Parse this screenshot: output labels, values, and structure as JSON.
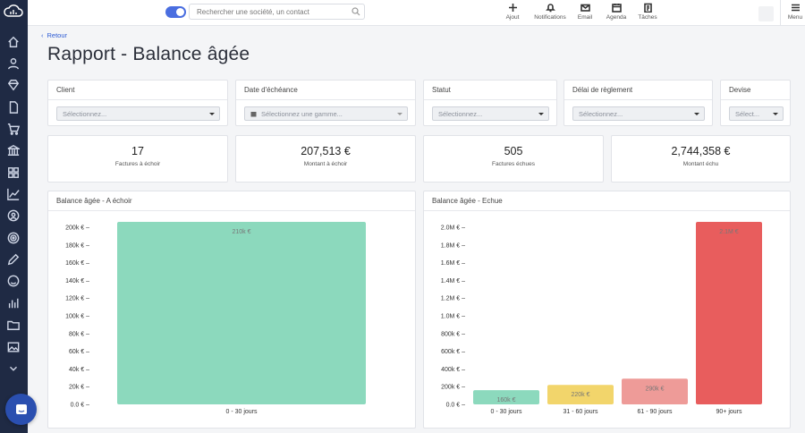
{
  "topbar": {
    "search_placeholder": "Rechercher une société, un contact",
    "actions": [
      {
        "label": "Ajout",
        "icon": "plus-icon"
      },
      {
        "label": "Notifications",
        "icon": "bell-icon"
      },
      {
        "label": "Email",
        "icon": "envelope-icon"
      },
      {
        "label": "Agenda",
        "icon": "calendar-icon"
      },
      {
        "label": "Tâches",
        "icon": "clipboard-icon"
      }
    ],
    "menu_label": "Menu"
  },
  "page": {
    "back_label": "Retour",
    "title": "Rapport - Balance âgée"
  },
  "filters": {
    "client": {
      "label": "Client",
      "placeholder": "Sélectionnez..."
    },
    "date": {
      "label": "Date d'échéance",
      "placeholder": "Sélectionnez une gamme..."
    },
    "statut": {
      "label": "Statut",
      "placeholder": "Sélectionnez..."
    },
    "delai": {
      "label": "Délai de règlement",
      "placeholder": "Sélectionnez..."
    },
    "devise": {
      "label": "Devise",
      "placeholder": "Sélect..."
    }
  },
  "kpis": [
    {
      "value": "17",
      "label": "Factures à échoir"
    },
    {
      "value": "207,513 €",
      "label": "Montant à échoir"
    },
    {
      "value": "505",
      "label": "Factures échues"
    },
    {
      "value": "2,744,358 €",
      "label": "Montant échu"
    }
  ],
  "chart_data": [
    {
      "type": "bar",
      "title": "Balance âgée - A échoir",
      "categories": [
        "0 - 30 jours"
      ],
      "values": [
        207513
      ],
      "data_labels": [
        "210k €"
      ],
      "y_ticks": [
        "0.0 € –",
        "20k € –",
        "40k € –",
        "60k € –",
        "80k € –",
        "100k € –",
        "120k € –",
        "140k € –",
        "160k € –",
        "180k € –",
        "200k € –"
      ],
      "ylim": [
        0,
        200000
      ],
      "colors": [
        "#8cd9bd"
      ]
    },
    {
      "type": "bar",
      "title": "Balance âgée - Echue",
      "categories": [
        "0 - 30 jours",
        "31 - 60 jours",
        "61 - 90 jours",
        "90+ jours"
      ],
      "values": [
        160000,
        220000,
        290000,
        2100000
      ],
      "data_labels": [
        "160k €",
        "220k €",
        "290k €",
        "2.1M €"
      ],
      "y_ticks": [
        "0.0 € –",
        "200k € –",
        "400k € –",
        "600k € –",
        "800k € –",
        "1.0M € –",
        "1.2M € –",
        "1.4M € –",
        "1.6M € –",
        "1.8M € –",
        "2.0M € –"
      ],
      "ylim": [
        0,
        2000000
      ],
      "colors": [
        "#8cd9bd",
        "#f2d56b",
        "#ee9b98",
        "#e85d5d"
      ]
    }
  ],
  "colors": {
    "sidebar": "#1f2a44",
    "accent": "#2d5bd3"
  }
}
